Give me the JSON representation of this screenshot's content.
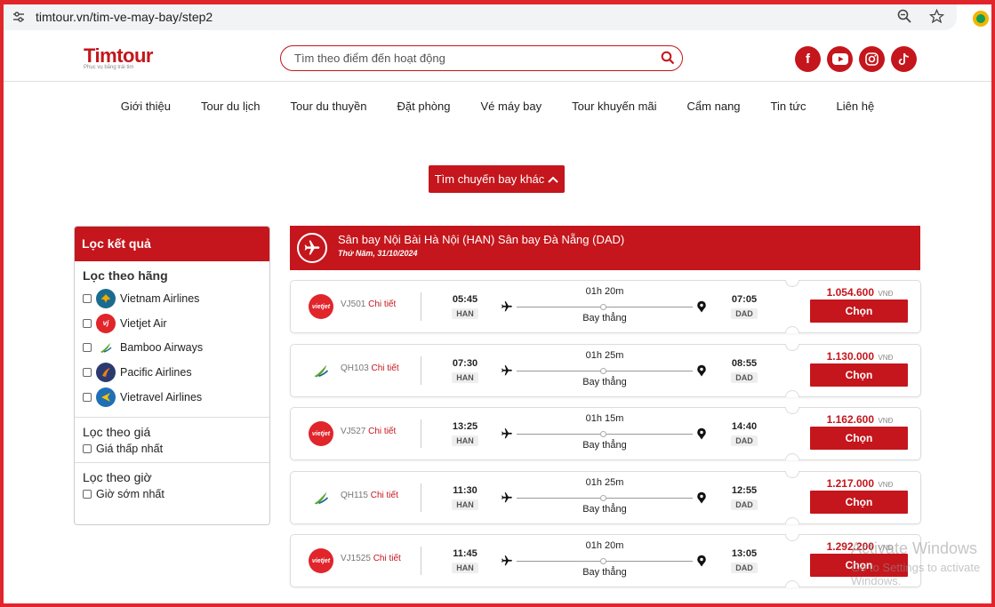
{
  "browser": {
    "url": "timtour.vn/tim-ve-may-bay/step2"
  },
  "header": {
    "logo_text": "Timtour",
    "logo_tagline": "Phục vụ bằng trái tim",
    "search_placeholder": "Tìm theo điểm đến hoạt động",
    "socials": [
      {
        "name": "facebook",
        "glyph": "f"
      },
      {
        "name": "youtube",
        "glyph": "▶"
      },
      {
        "name": "instagram",
        "glyph": "◎"
      },
      {
        "name": "tiktok",
        "glyph": "♪"
      }
    ]
  },
  "nav": [
    "Giới thiệu",
    "Tour du lịch",
    "Tour du thuyền",
    "Đặt phòng",
    "Vé máy bay",
    "Tour khuyến mãi",
    "Cẩm nang",
    "Tin tức",
    "Liên hệ"
  ],
  "search_again_label": "Tìm chuyến bay khác",
  "filter": {
    "title": "Lọc kết quả",
    "airline_title": "Lọc theo hãng",
    "airlines": [
      {
        "label": "Vietnam Airlines",
        "color": "#1a6c8e"
      },
      {
        "label": "Vietjet Air",
        "color": "#e0252b"
      },
      {
        "label": "Bamboo Airways",
        "color": "#ffffff"
      },
      {
        "label": "Pacific Airlines",
        "color": "#2a3a6e"
      },
      {
        "label": "Vietravel Airlines",
        "color": "#1f6fb5"
      }
    ],
    "price_title": "Lọc theo giá",
    "price_option": "Giá thấp nhất",
    "time_title": "Lọc theo giờ",
    "time_option": "Giờ sớm nhất"
  },
  "route": {
    "title": "Sân bay Nội Bài Hà Nội (HAN)  Sân bay Đà Nẵng (DAD)",
    "date": "Thứ Năm, 31/10/2024"
  },
  "detail_label": "Chi tiết",
  "choose_label": "Chọn",
  "currency": "VNĐ",
  "flights": [
    {
      "airline": "vietjet",
      "code": "VJ501",
      "dep_time": "05:45",
      "dep_code": "HAN",
      "duration": "01h 20m",
      "type": "Bay thẳng",
      "arr_time": "07:05",
      "arr_code": "DAD",
      "price": "1.054.600"
    },
    {
      "airline": "bamboo",
      "code": "QH103",
      "dep_time": "07:30",
      "dep_code": "HAN",
      "duration": "01h 25m",
      "type": "Bay thẳng",
      "arr_time": "08:55",
      "arr_code": "DAD",
      "price": "1.130.000"
    },
    {
      "airline": "vietjet",
      "code": "VJ527",
      "dep_time": "13:25",
      "dep_code": "HAN",
      "duration": "01h 15m",
      "type": "Bay thẳng",
      "arr_time": "14:40",
      "arr_code": "DAD",
      "price": "1.162.600"
    },
    {
      "airline": "bamboo",
      "code": "QH115",
      "dep_time": "11:30",
      "dep_code": "HAN",
      "duration": "01h 25m",
      "type": "Bay thẳng",
      "arr_time": "12:55",
      "arr_code": "DAD",
      "price": "1.217.000"
    },
    {
      "airline": "vietjet",
      "code": "VJ1525",
      "dep_time": "11:45",
      "dep_code": "HAN",
      "duration": "01h 20m",
      "type": "Bay thẳng",
      "arr_time": "13:05",
      "arr_code": "DAD",
      "price": "1.292.200"
    }
  ],
  "watermark": {
    "title": "Activate Windows",
    "subtitle": "Go to Settings to activate Windows."
  }
}
